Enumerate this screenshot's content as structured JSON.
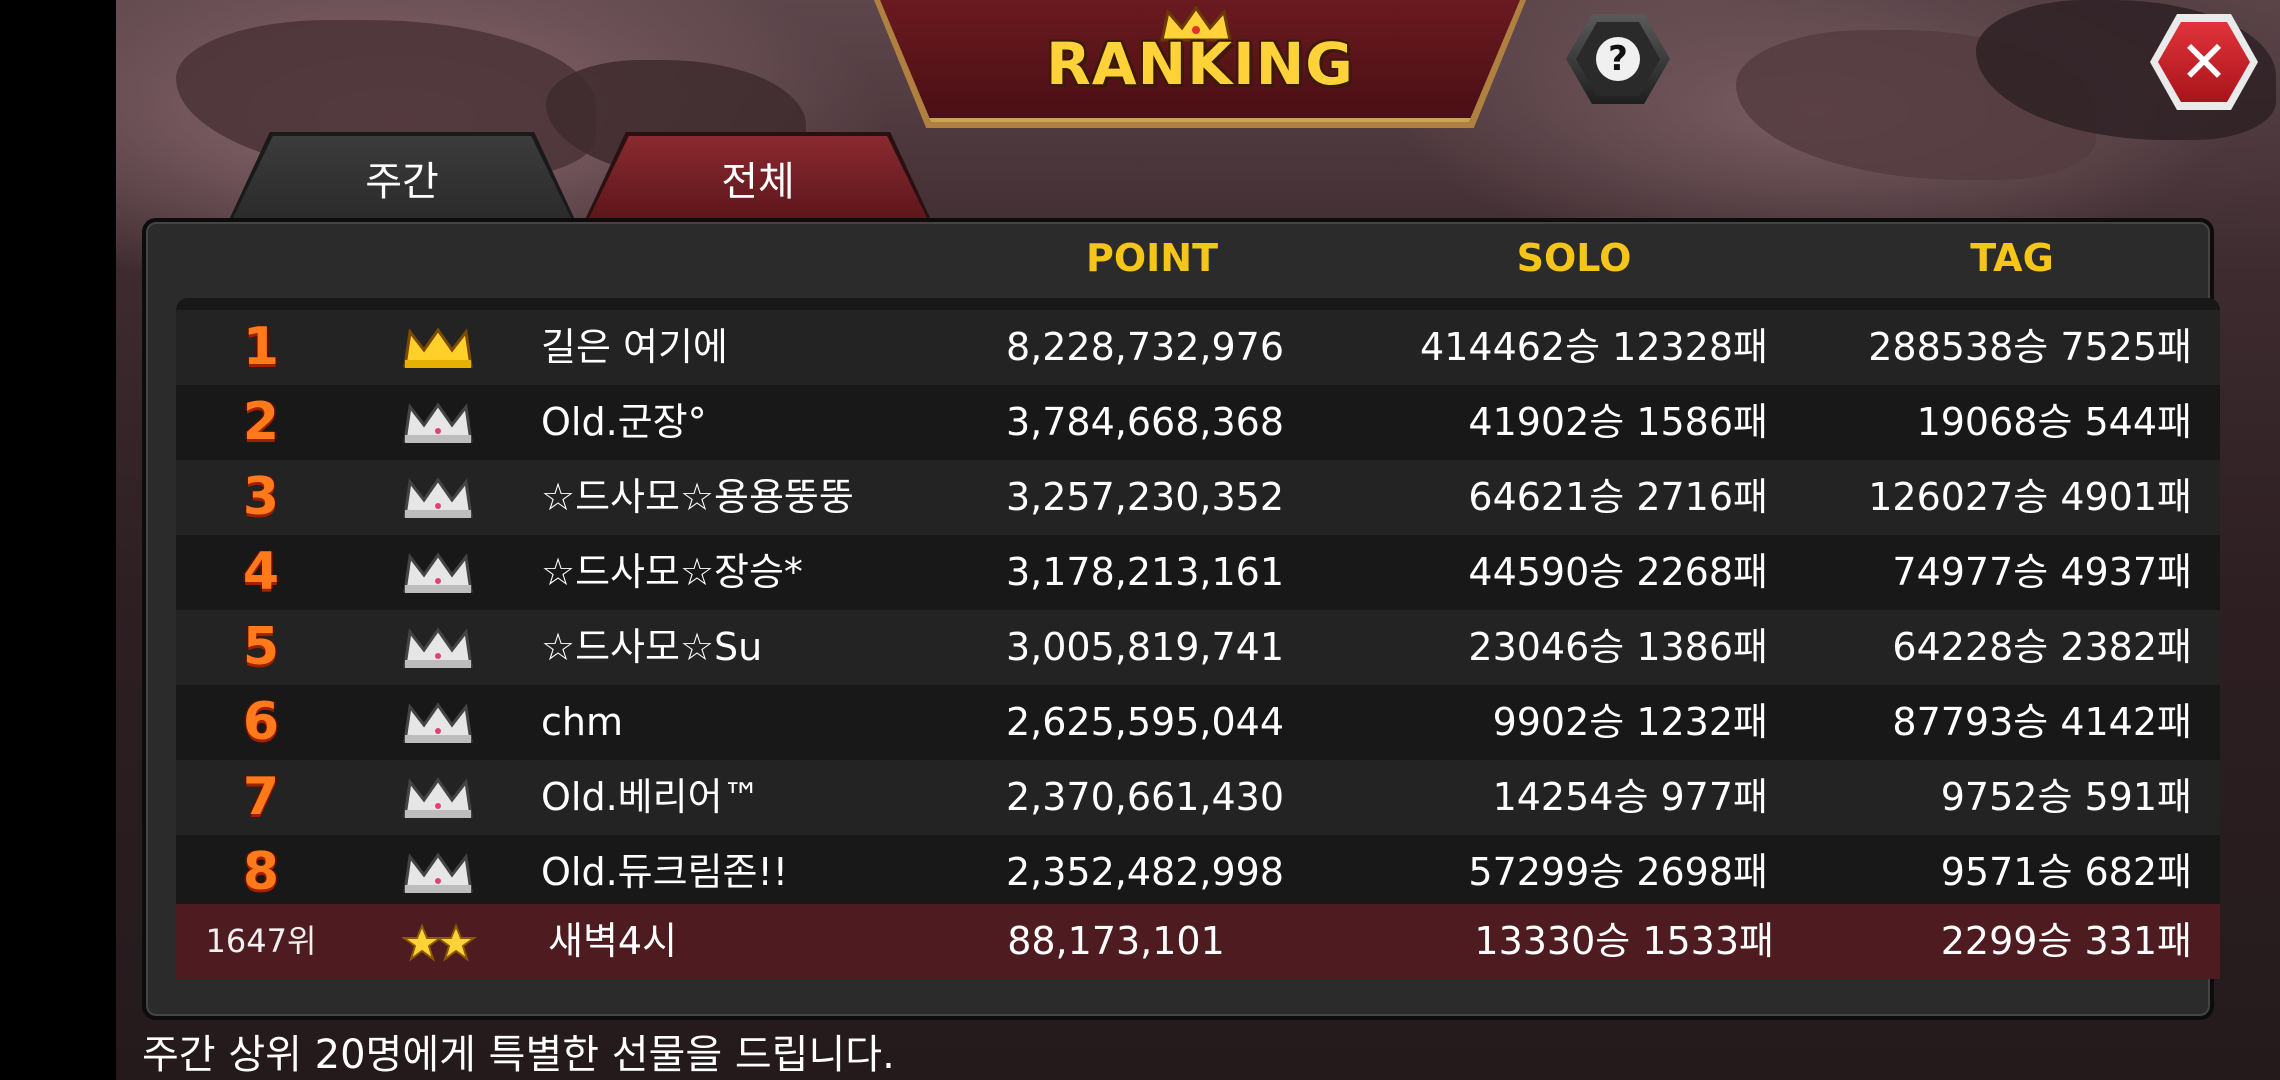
{
  "header": {
    "title": "RANKING"
  },
  "tabs": [
    {
      "label": "주간",
      "active": true
    },
    {
      "label": "전체",
      "active": false
    }
  ],
  "columns": {
    "point": "POINT",
    "solo": "SOLO",
    "tag": "TAG"
  },
  "rows": [
    {
      "rank": "1",
      "crown": "gold-crown",
      "name": "길은 여기에",
      "point": "8,228,732,976",
      "solo": "414462승 12328패",
      "tag": "288538승 7525패"
    },
    {
      "rank": "2",
      "crown": "silver-crown",
      "name": "Old.군장°",
      "point": "3,784,668,368",
      "solo": "41902승 1586패",
      "tag": "19068승 544패"
    },
    {
      "rank": "3",
      "crown": "silver-crown",
      "name": "☆드사모☆용용뚱뚱",
      "point": "3,257,230,352",
      "solo": "64621승 2716패",
      "tag": "126027승 4901패"
    },
    {
      "rank": "4",
      "crown": "silver-crown",
      "name": "☆드사모☆장승*",
      "point": "3,178,213,161",
      "solo": "44590승 2268패",
      "tag": "74977승 4937패"
    },
    {
      "rank": "5",
      "crown": "silver-crown",
      "name": "☆드사모☆Su",
      "point": "3,005,819,741",
      "solo": "23046승 1386패",
      "tag": "64228승 2382패"
    },
    {
      "rank": "6",
      "crown": "silver-crown",
      "name": "chm",
      "point": "2,625,595,044",
      "solo": "9902승 1232패",
      "tag": "87793승 4142패"
    },
    {
      "rank": "7",
      "crown": "silver-crown",
      "name": "Old.베리어™",
      "point": "2,370,661,430",
      "solo": "14254승 977패",
      "tag": "9752승 591패"
    },
    {
      "rank": "8",
      "crown": "silver-crown",
      "name": "Old.듀크림존!!",
      "point": "2,352,482,998",
      "solo": "57299승 2698패",
      "tag": "9571승 682패"
    }
  ],
  "my_row": {
    "rank": "1647위",
    "badge": "two-stars",
    "name": "새벽4시",
    "point": "88,173,101",
    "solo": "13330승 1533패",
    "tag": "2299승 331패"
  },
  "footer": {
    "note": "주간 상위 20명에게 특별한 선물을 드립니다."
  },
  "colors": {
    "accent_gold": "#f5c518",
    "rank_orange": "#ff7a1a",
    "my_row_bg": "#4e1c20",
    "close_red": "#d0262d"
  }
}
